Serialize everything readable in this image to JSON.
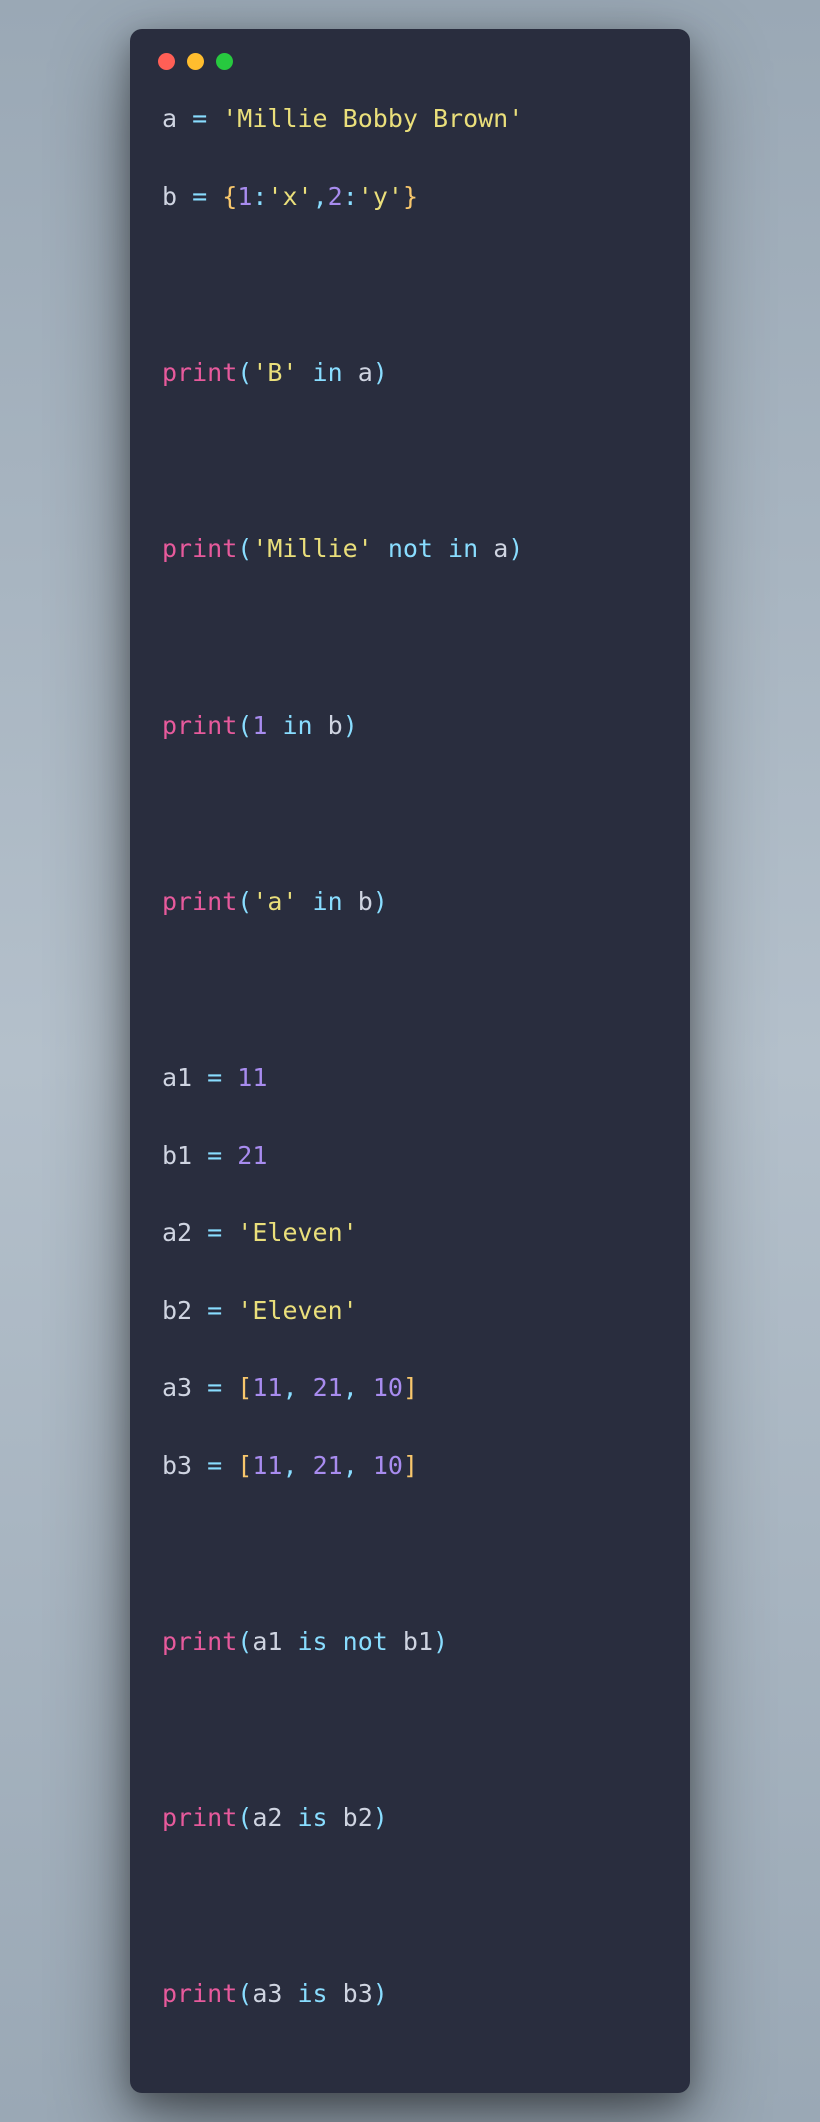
{
  "window": {
    "dots": {
      "red": "#ff5f56",
      "yellow": "#ffbd2e",
      "green": "#27c93f"
    }
  },
  "code": {
    "lines": [
      {
        "type": "code",
        "tokens": [
          {
            "t": "a",
            "c": "tk-var"
          },
          {
            "t": " "
          },
          {
            "t": "=",
            "c": "tk-op"
          },
          {
            "t": " "
          },
          {
            "t": "'Millie Bobby Brown'",
            "c": "tk-str"
          }
        ]
      },
      {
        "type": "code",
        "tokens": [
          {
            "t": "b",
            "c": "tk-var"
          },
          {
            "t": " "
          },
          {
            "t": "=",
            "c": "tk-op"
          },
          {
            "t": " "
          },
          {
            "t": "{",
            "c": "tk-brace"
          },
          {
            "t": "1",
            "c": "tk-num"
          },
          {
            "t": ":",
            "c": "tk-punc"
          },
          {
            "t": "'x'",
            "c": "tk-str"
          },
          {
            "t": ",",
            "c": "tk-punc"
          },
          {
            "t": "2",
            "c": "tk-num"
          },
          {
            "t": ":",
            "c": "tk-punc"
          },
          {
            "t": "'y'",
            "c": "tk-str"
          },
          {
            "t": "}",
            "c": "tk-brace"
          }
        ]
      },
      {
        "type": "gap"
      },
      {
        "type": "code",
        "tokens": [
          {
            "t": "print",
            "c": "tk-func"
          },
          {
            "t": "(",
            "c": "tk-punc"
          },
          {
            "t": "'B'",
            "c": "tk-str"
          },
          {
            "t": " "
          },
          {
            "t": "in",
            "c": "tk-op"
          },
          {
            "t": " "
          },
          {
            "t": "a",
            "c": "tk-var"
          },
          {
            "t": ")",
            "c": "tk-punc"
          }
        ]
      },
      {
        "type": "gap"
      },
      {
        "type": "code",
        "tokens": [
          {
            "t": "print",
            "c": "tk-func"
          },
          {
            "t": "(",
            "c": "tk-punc"
          },
          {
            "t": "'Millie'",
            "c": "tk-str"
          },
          {
            "t": " "
          },
          {
            "t": "not",
            "c": "tk-op"
          },
          {
            "t": " "
          },
          {
            "t": "in",
            "c": "tk-op"
          },
          {
            "t": " "
          },
          {
            "t": "a",
            "c": "tk-var"
          },
          {
            "t": ")",
            "c": "tk-punc"
          }
        ]
      },
      {
        "type": "gap"
      },
      {
        "type": "code",
        "tokens": [
          {
            "t": "print",
            "c": "tk-func"
          },
          {
            "t": "(",
            "c": "tk-punc"
          },
          {
            "t": "1",
            "c": "tk-num"
          },
          {
            "t": " "
          },
          {
            "t": "in",
            "c": "tk-op"
          },
          {
            "t": " "
          },
          {
            "t": "b",
            "c": "tk-var"
          },
          {
            "t": ")",
            "c": "tk-punc"
          }
        ]
      },
      {
        "type": "gap"
      },
      {
        "type": "code",
        "tokens": [
          {
            "t": "print",
            "c": "tk-func"
          },
          {
            "t": "(",
            "c": "tk-punc"
          },
          {
            "t": "'a'",
            "c": "tk-str"
          },
          {
            "t": " "
          },
          {
            "t": "in",
            "c": "tk-op"
          },
          {
            "t": " "
          },
          {
            "t": "b",
            "c": "tk-var"
          },
          {
            "t": ")",
            "c": "tk-punc"
          }
        ]
      },
      {
        "type": "gap"
      },
      {
        "type": "code",
        "tokens": [
          {
            "t": "a1",
            "c": "tk-var"
          },
          {
            "t": " "
          },
          {
            "t": "=",
            "c": "tk-op"
          },
          {
            "t": " "
          },
          {
            "t": "11",
            "c": "tk-num"
          }
        ]
      },
      {
        "type": "code",
        "tokens": [
          {
            "t": "b1",
            "c": "tk-var"
          },
          {
            "t": " "
          },
          {
            "t": "=",
            "c": "tk-op"
          },
          {
            "t": " "
          },
          {
            "t": "21",
            "c": "tk-num"
          }
        ]
      },
      {
        "type": "code",
        "tokens": [
          {
            "t": "a2",
            "c": "tk-var"
          },
          {
            "t": " "
          },
          {
            "t": "=",
            "c": "tk-op"
          },
          {
            "t": " "
          },
          {
            "t": "'Eleven'",
            "c": "tk-str"
          }
        ]
      },
      {
        "type": "code",
        "tokens": [
          {
            "t": "b2",
            "c": "tk-var"
          },
          {
            "t": " "
          },
          {
            "t": "=",
            "c": "tk-op"
          },
          {
            "t": " "
          },
          {
            "t": "'Eleven'",
            "c": "tk-str"
          }
        ]
      },
      {
        "type": "code",
        "tokens": [
          {
            "t": "a3",
            "c": "tk-var"
          },
          {
            "t": " "
          },
          {
            "t": "=",
            "c": "tk-op"
          },
          {
            "t": " "
          },
          {
            "t": "[",
            "c": "tk-brace"
          },
          {
            "t": "11",
            "c": "tk-num"
          },
          {
            "t": ",",
            "c": "tk-punc"
          },
          {
            "t": " "
          },
          {
            "t": "21",
            "c": "tk-num"
          },
          {
            "t": ",",
            "c": "tk-punc"
          },
          {
            "t": " "
          },
          {
            "t": "10",
            "c": "tk-num"
          },
          {
            "t": "]",
            "c": "tk-brace"
          }
        ]
      },
      {
        "type": "code",
        "tokens": [
          {
            "t": "b3",
            "c": "tk-var"
          },
          {
            "t": " "
          },
          {
            "t": "=",
            "c": "tk-op"
          },
          {
            "t": " "
          },
          {
            "t": "[",
            "c": "tk-brace"
          },
          {
            "t": "11",
            "c": "tk-num"
          },
          {
            "t": ",",
            "c": "tk-punc"
          },
          {
            "t": " "
          },
          {
            "t": "21",
            "c": "tk-num"
          },
          {
            "t": ",",
            "c": "tk-punc"
          },
          {
            "t": " "
          },
          {
            "t": "10",
            "c": "tk-num"
          },
          {
            "t": "]",
            "c": "tk-brace"
          }
        ]
      },
      {
        "type": "gap"
      },
      {
        "type": "code",
        "tokens": [
          {
            "t": "print",
            "c": "tk-func"
          },
          {
            "t": "(",
            "c": "tk-punc"
          },
          {
            "t": "a1",
            "c": "tk-var"
          },
          {
            "t": " "
          },
          {
            "t": "is",
            "c": "tk-op"
          },
          {
            "t": " "
          },
          {
            "t": "not",
            "c": "tk-op"
          },
          {
            "t": " "
          },
          {
            "t": "b1",
            "c": "tk-var"
          },
          {
            "t": ")",
            "c": "tk-punc"
          }
        ]
      },
      {
        "type": "gap"
      },
      {
        "type": "code",
        "tokens": [
          {
            "t": "print",
            "c": "tk-func"
          },
          {
            "t": "(",
            "c": "tk-punc"
          },
          {
            "t": "a2",
            "c": "tk-var"
          },
          {
            "t": " "
          },
          {
            "t": "is",
            "c": "tk-op"
          },
          {
            "t": " "
          },
          {
            "t": "b2",
            "c": "tk-var"
          },
          {
            "t": ")",
            "c": "tk-punc"
          }
        ]
      },
      {
        "type": "gap"
      },
      {
        "type": "code",
        "tokens": [
          {
            "t": "print",
            "c": "tk-func"
          },
          {
            "t": "(",
            "c": "tk-punc"
          },
          {
            "t": "a3",
            "c": "tk-var"
          },
          {
            "t": " "
          },
          {
            "t": "is",
            "c": "tk-op"
          },
          {
            "t": " "
          },
          {
            "t": "b3",
            "c": "tk-var"
          },
          {
            "t": ")",
            "c": "tk-punc"
          }
        ]
      }
    ]
  }
}
